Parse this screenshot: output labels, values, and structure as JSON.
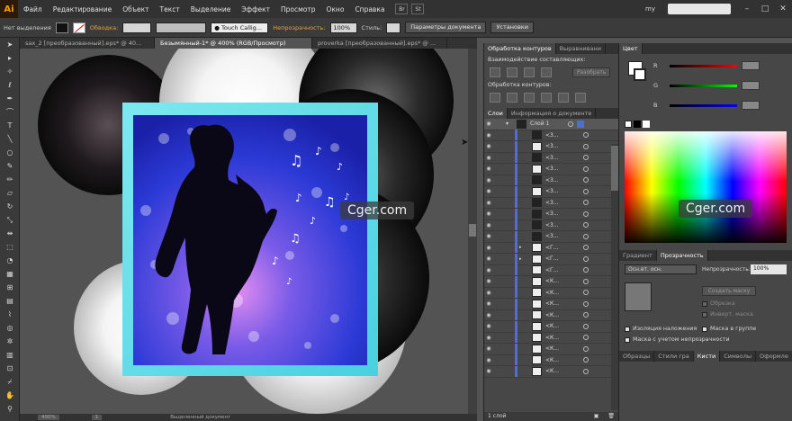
{
  "app": {
    "logo": "Ai",
    "user": "my",
    "search_placeholder": ""
  },
  "menu": [
    "Файл",
    "Редактирование",
    "Объект",
    "Текст",
    "Выделение",
    "Эффект",
    "Просмотр",
    "Окно",
    "Справка"
  ],
  "menu_extras": {
    "br": "Br",
    "st": "St"
  },
  "control_bar": {
    "selection": "Нет выделения",
    "stroke_label": "Обводка:",
    "brush": "Touch Callig...",
    "opacity_label": "Непрозрачность:",
    "opacity_value": "100%",
    "style_label": "Стиль:",
    "doc_settings": "Параметры документа",
    "prefs": "Установки"
  },
  "doc_tabs": [
    {
      "label": "sax_2 [преобразованный].eps* @ 40...",
      "active": false
    },
    {
      "label": "Безымянный-1* @ 400% (RGB/Просмотр)",
      "active": true
    },
    {
      "label": "proverka [преобразованный].eps* @ ...",
      "active": false
    }
  ],
  "status": {
    "zoom": "400%",
    "page": "1",
    "info": "Выделенный документ"
  },
  "watermark": "Cger.com",
  "pathfinder": {
    "tabs": [
      "Обработка контуров",
      "Выравнивани"
    ],
    "shape_modes": "Взаимодействие составляющих:",
    "expand": "Разобрать",
    "pathfinders": "Обработка контуров:"
  },
  "layers": {
    "tabs": [
      "Слои",
      "Информация о документе"
    ],
    "top_layer": "Слой 1",
    "rows": [
      "<3...",
      "<3...",
      "<3...",
      "<3...",
      "<3...",
      "<3...",
      "<3...",
      "<3...",
      "<3...",
      "<3...",
      "<Г...",
      "<Г...",
      "<Г...",
      "<К...",
      "<К...",
      "<К...",
      "<К...",
      "<К...",
      "<К...",
      "<К...",
      "<К...",
      "<К..."
    ],
    "footer": "1 слой"
  },
  "color": {
    "tab": "Цвет",
    "channels": [
      "R",
      "G",
      "B"
    ]
  },
  "transparency": {
    "tabs": [
      "Градиент",
      "Прозрачность"
    ],
    "blend_mode": "Осн.ет. осн.",
    "opacity_label": "Непрозрачность:",
    "opacity_value": "100%",
    "make_mask": "Создать маску",
    "clip": "Обрезка",
    "invert": "Инверт. маска",
    "isolate": "Изоляция наложения",
    "knockout": "Маска в группе",
    "opacity_mask": "Маска с учетом непрозрачности"
  },
  "bottom_tabs": [
    "Образцы",
    "Стили гра",
    "Кисти",
    "Символы",
    "Оформле"
  ],
  "colors": {
    "accent": "#ff9a00",
    "bg_dark": "#323232",
    "layer_bar": "#4d6fd0"
  }
}
